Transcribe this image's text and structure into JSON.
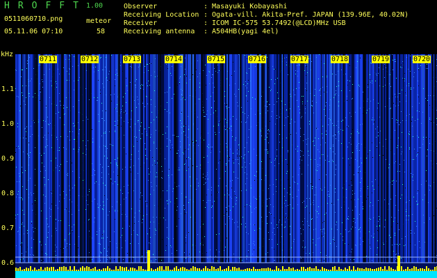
{
  "header": {
    "app_title": "HROFFT",
    "version": "1.00",
    "filename": "0511060710.png",
    "meteor_label": "meteor",
    "datetime": "05.11.06 07:10",
    "meteor_count": "58"
  },
  "station_info": [
    {
      "key": "Observer",
      "value": ": Masayuki Kobayashi"
    },
    {
      "key": "Receiving Location",
      "value": ": Ogata-vill. Akita-Pref. JAPAN (139.96E, 40.02N)"
    },
    {
      "key": "Receiver",
      "value": ": ICOM IC-575 53.7492(@LCD)MHz USB"
    },
    {
      "key": "Receiving antenna",
      "value": ": A504HB(yagi 4el)"
    }
  ],
  "spectrogram": {
    "y_unit": "kHz",
    "y_ticks": [
      "1.1",
      "1.0",
      "0.9",
      "0.8",
      "0.7",
      "0.6"
    ],
    "time_ticks": [
      "0711",
      "0712",
      "0713",
      "0714",
      "0715",
      "0716",
      "0717",
      "0718",
      "0719",
      "0720"
    ],
    "colors": {
      "background": "#00105a",
      "signal_low": "#1e46ff",
      "signal_high": "#2affd0",
      "tick_label_bg": "#ffff00",
      "trace": "#ffff00",
      "baseline": "#00e5ff"
    }
  }
}
